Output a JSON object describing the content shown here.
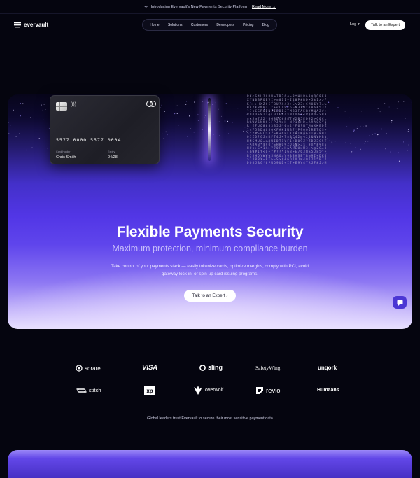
{
  "announcement": {
    "text": "Introducing Evervault's New Payments Security Platform",
    "link": "Read More →"
  },
  "nav": {
    "brand": "evervault",
    "items": [
      "Home",
      "Solutions",
      "Customers",
      "Developers",
      "Pricing",
      "Blog"
    ],
    "login": "Log in",
    "cta": "Talk to an Expert"
  },
  "card": {
    "number": "5577 0000 5577 0004",
    "holder_label": "Card Holder",
    "holder": "Chris Smith",
    "expiry_label": "Expiry",
    "expiry": "04/28"
  },
  "hero": {
    "title": "Flexible Payments Security",
    "subtitle": "Maximum protection, minimum compliance burden",
    "description": "Take control of your payments stack — easily tokenize cards, optimize margins, comply with PCI, avoid gateway lock-in, or spin-up card issuing programs.",
    "cta": "Talk to an Expert ›"
  },
  "logos": {
    "row1": [
      "sorare",
      "VISA",
      "sling",
      "SafetyWing",
      "unqork"
    ],
    "row2": [
      "stitch",
      "xp",
      "overwolf",
      "revio",
      "Humaans"
    ],
    "caption": "Global leaders trust Evervault to secure their most sensitive payment data"
  },
  "colors": {
    "background": "#05050f",
    "accent": "#5236e6",
    "chat_button": "#4b36d4"
  },
  "icons": {
    "announcement": "sparkle-icon",
    "chat": "chat-bubble-icon",
    "card_brand": "mastercard-icon"
  }
}
